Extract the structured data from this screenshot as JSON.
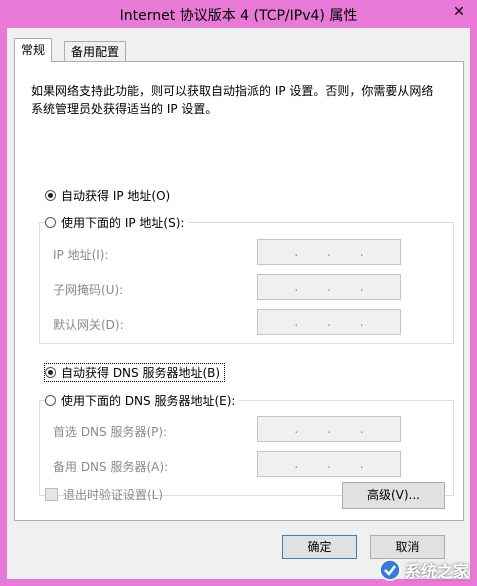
{
  "window": {
    "title": "Internet 协议版本 4 (TCP/IPv4) 属性",
    "close": "✕"
  },
  "tabs": [
    {
      "label": "常规",
      "active": true
    },
    {
      "label": "备用配置",
      "active": false
    }
  ],
  "description": "如果网络支持此功能，则可以获取自动指派的 IP 设置。否则，你需要从网络系统管理员处获得适当的 IP 设置。",
  "ip": {
    "auto_label": "自动获得 IP 地址(O)",
    "auto_selected": true,
    "manual_label": "使用下面的 IP 地址(S):",
    "fields": [
      {
        "label": "IP 地址(I):"
      },
      {
        "label": "子网掩码(U):"
      },
      {
        "label": "默认网关(D):"
      }
    ]
  },
  "dns": {
    "auto_label": "自动获得 DNS 服务器地址(B)",
    "auto_selected": true,
    "manual_label": "使用下面的 DNS 服务器地址(E):",
    "fields": [
      {
        "label": "首选 DNS 服务器(P):"
      },
      {
        "label": "备用 DNS 服务器(A):"
      }
    ]
  },
  "validate_label": "退出时验证设置(L)",
  "advanced_label": "高级(V)...",
  "ok_label": "确定",
  "cancel_label": "取消",
  "watermark": "系统之家",
  "ip_dots": ".",
  "colors": {
    "title_bar": "#e879d6",
    "panel": "#ffffff",
    "disabled_text": "#8a8a8a"
  }
}
